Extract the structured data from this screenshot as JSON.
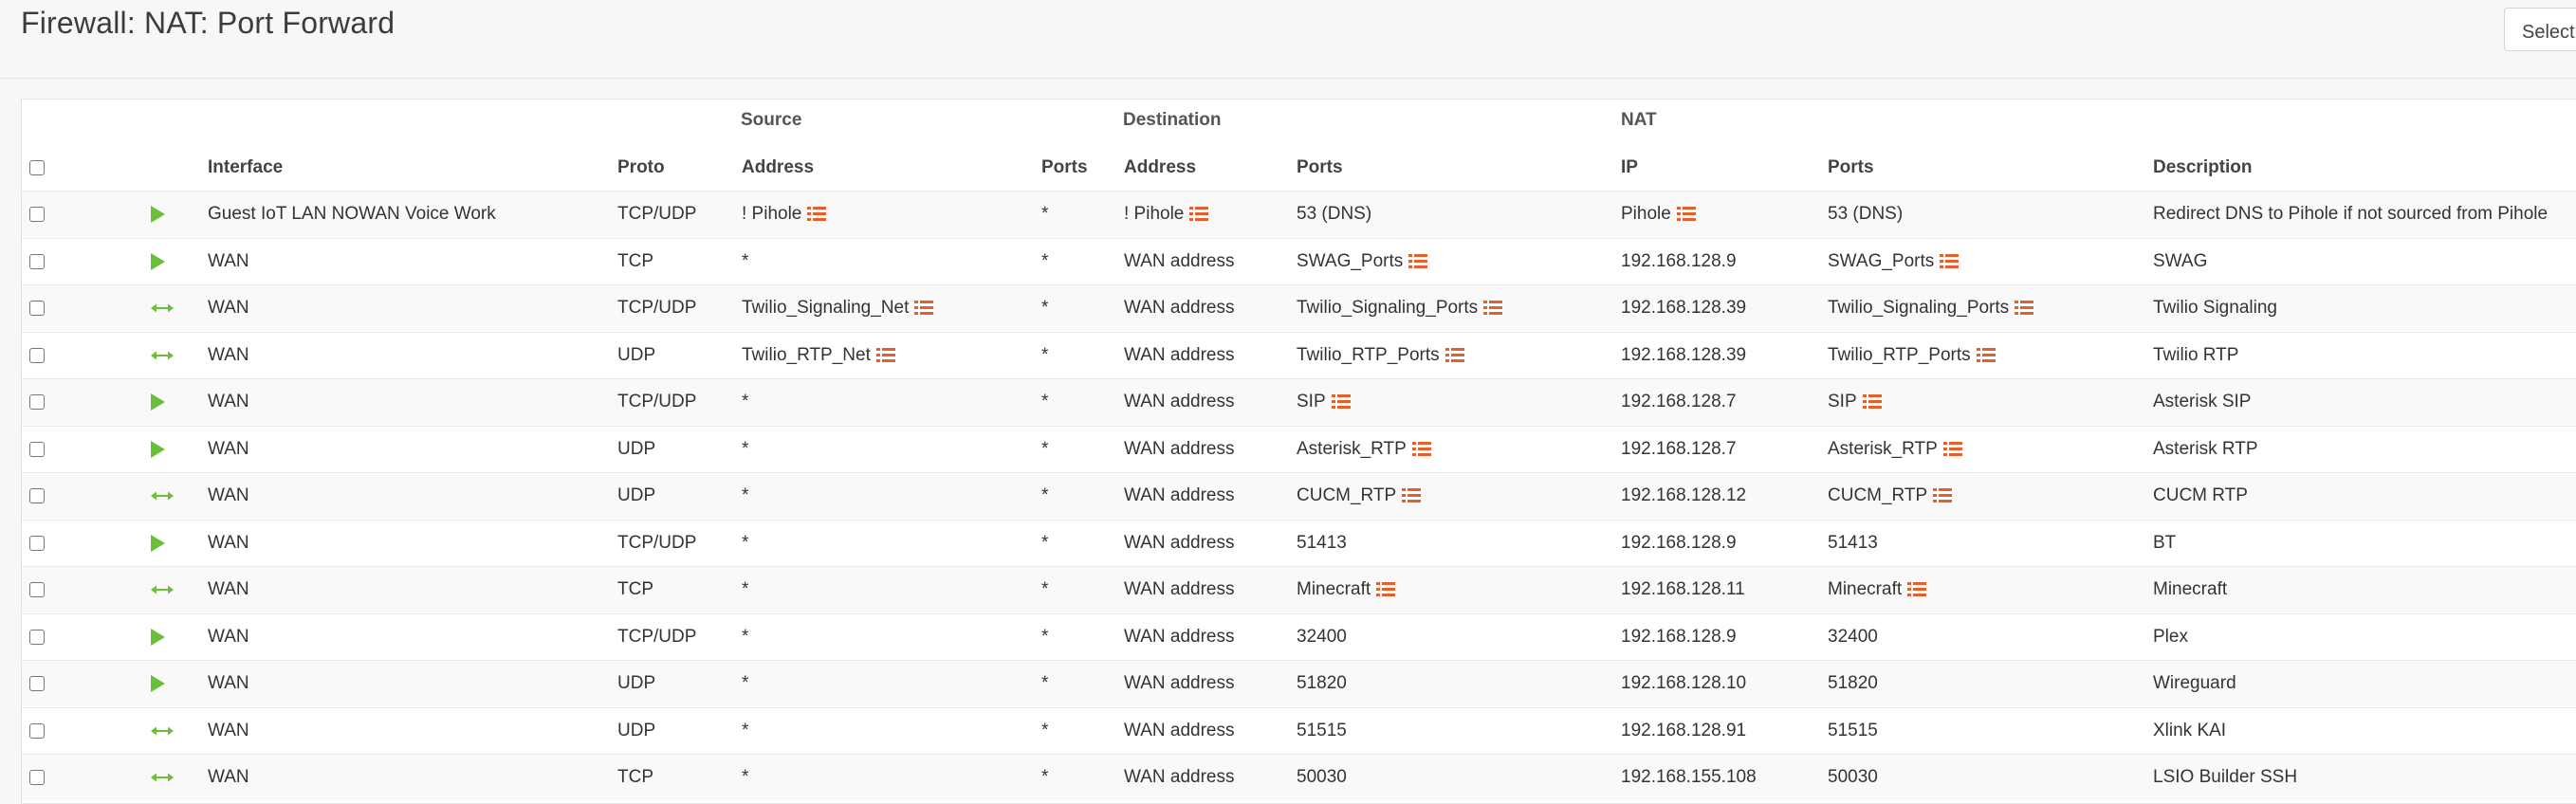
{
  "page": {
    "title": "Firewall: NAT: Port Forward",
    "select_button": "Select"
  },
  "table": {
    "groups": {
      "source": "Source",
      "destination": "Destination",
      "nat": "NAT"
    },
    "headers": {
      "interface": "Interface",
      "proto": "Proto",
      "src_address": "Address",
      "src_ports": "Ports",
      "dst_address": "Address",
      "dst_ports": "Ports",
      "nat_ip": "IP",
      "nat_ports": "Ports",
      "description": "Description"
    },
    "rows": [
      {
        "icon": "play",
        "interface": "Guest IoT LAN NOWAN Voice Work",
        "proto": "TCP/UDP",
        "src_address": "! Pihole",
        "src_alias": true,
        "src_ports": "*",
        "dst_address": "! Pihole",
        "dst_alias": true,
        "dst_ports": "53 (DNS)",
        "dst_ports_alias": false,
        "nat_ip": "Pihole",
        "nat_ip_alias": true,
        "nat_ports": "53 (DNS)",
        "nat_ports_alias": false,
        "description": "Redirect DNS to Pihole if not sourced from Pihole"
      },
      {
        "icon": "play",
        "interface": "WAN",
        "proto": "TCP",
        "src_address": "*",
        "src_alias": false,
        "src_ports": "*",
        "dst_address": "WAN address",
        "dst_alias": false,
        "dst_ports": "SWAG_Ports",
        "dst_ports_alias": true,
        "nat_ip": "192.168.128.9",
        "nat_ip_alias": false,
        "nat_ports": "SWAG_Ports",
        "nat_ports_alias": true,
        "description": "SWAG"
      },
      {
        "icon": "arrows",
        "interface": "WAN",
        "proto": "TCP/UDP",
        "src_address": "Twilio_Signaling_Net",
        "src_alias": true,
        "src_ports": "*",
        "dst_address": "WAN address",
        "dst_alias": false,
        "dst_ports": "Twilio_Signaling_Ports",
        "dst_ports_alias": true,
        "nat_ip": "192.168.128.39",
        "nat_ip_alias": false,
        "nat_ports": "Twilio_Signaling_Ports",
        "nat_ports_alias": true,
        "description": "Twilio Signaling"
      },
      {
        "icon": "arrows",
        "interface": "WAN",
        "proto": "UDP",
        "src_address": "Twilio_RTP_Net",
        "src_alias": true,
        "src_ports": "*",
        "dst_address": "WAN address",
        "dst_alias": false,
        "dst_ports": "Twilio_RTP_Ports",
        "dst_ports_alias": true,
        "nat_ip": "192.168.128.39",
        "nat_ip_alias": false,
        "nat_ports": "Twilio_RTP_Ports",
        "nat_ports_alias": true,
        "description": "Twilio RTP"
      },
      {
        "icon": "play",
        "interface": "WAN",
        "proto": "TCP/UDP",
        "src_address": "*",
        "src_alias": false,
        "src_ports": "*",
        "dst_address": "WAN address",
        "dst_alias": false,
        "dst_ports": "SIP",
        "dst_ports_alias": true,
        "nat_ip": "192.168.128.7",
        "nat_ip_alias": false,
        "nat_ports": "SIP",
        "nat_ports_alias": true,
        "description": "Asterisk SIP"
      },
      {
        "icon": "play",
        "interface": "WAN",
        "proto": "UDP",
        "src_address": "*",
        "src_alias": false,
        "src_ports": "*",
        "dst_address": "WAN address",
        "dst_alias": false,
        "dst_ports": "Asterisk_RTP",
        "dst_ports_alias": true,
        "nat_ip": "192.168.128.7",
        "nat_ip_alias": false,
        "nat_ports": "Asterisk_RTP",
        "nat_ports_alias": true,
        "description": "Asterisk RTP"
      },
      {
        "icon": "arrows",
        "interface": "WAN",
        "proto": "UDP",
        "src_address": "*",
        "src_alias": false,
        "src_ports": "*",
        "dst_address": "WAN address",
        "dst_alias": false,
        "dst_ports": "CUCM_RTP",
        "dst_ports_alias": true,
        "nat_ip": "192.168.128.12",
        "nat_ip_alias": false,
        "nat_ports": "CUCM_RTP",
        "nat_ports_alias": true,
        "description": "CUCM RTP"
      },
      {
        "icon": "play",
        "interface": "WAN",
        "proto": "TCP/UDP",
        "src_address": "*",
        "src_alias": false,
        "src_ports": "*",
        "dst_address": "WAN address",
        "dst_alias": false,
        "dst_ports": "51413",
        "dst_ports_alias": false,
        "nat_ip": "192.168.128.9",
        "nat_ip_alias": false,
        "nat_ports": "51413",
        "nat_ports_alias": false,
        "description": "BT"
      },
      {
        "icon": "arrows",
        "interface": "WAN",
        "proto": "TCP",
        "src_address": "*",
        "src_alias": false,
        "src_ports": "*",
        "dst_address": "WAN address",
        "dst_alias": false,
        "dst_ports": "Minecraft",
        "dst_ports_alias": true,
        "nat_ip": "192.168.128.11",
        "nat_ip_alias": false,
        "nat_ports": "Minecraft",
        "nat_ports_alias": true,
        "description": "Minecraft"
      },
      {
        "icon": "play",
        "interface": "WAN",
        "proto": "TCP/UDP",
        "src_address": "*",
        "src_alias": false,
        "src_ports": "*",
        "dst_address": "WAN address",
        "dst_alias": false,
        "dst_ports": "32400",
        "dst_ports_alias": false,
        "nat_ip": "192.168.128.9",
        "nat_ip_alias": false,
        "nat_ports": "32400",
        "nat_ports_alias": false,
        "description": "Plex"
      },
      {
        "icon": "play",
        "interface": "WAN",
        "proto": "UDP",
        "src_address": "*",
        "src_alias": false,
        "src_ports": "*",
        "dst_address": "WAN address",
        "dst_alias": false,
        "dst_ports": "51820",
        "dst_ports_alias": false,
        "nat_ip": "192.168.128.10",
        "nat_ip_alias": false,
        "nat_ports": "51820",
        "nat_ports_alias": false,
        "description": "Wireguard"
      },
      {
        "icon": "arrows",
        "interface": "WAN",
        "proto": "UDP",
        "src_address": "*",
        "src_alias": false,
        "src_ports": "*",
        "dst_address": "WAN address",
        "dst_alias": false,
        "dst_ports": "51515",
        "dst_ports_alias": false,
        "nat_ip": "192.168.128.91",
        "nat_ip_alias": false,
        "nat_ports": "51515",
        "nat_ports_alias": false,
        "description": "Xlink KAI"
      },
      {
        "icon": "arrows",
        "interface": "WAN",
        "proto": "TCP",
        "src_address": "*",
        "src_alias": false,
        "src_ports": "*",
        "dst_address": "WAN address",
        "dst_alias": false,
        "dst_ports": "50030",
        "dst_ports_alias": false,
        "nat_ip": "192.168.155.108",
        "nat_ip_alias": false,
        "nat_ports": "50030",
        "nat_ports_alias": false,
        "description": "LSIO Builder SSH"
      }
    ]
  },
  "colors": {
    "play_icon": "#6abf3a",
    "alias_icon": "#e35f2b",
    "row_alt": "#f9f9f9"
  },
  "icons": {
    "play": "play-triangle-icon",
    "arrows": "double-arrow-icon",
    "alias": "alias-list-icon"
  }
}
